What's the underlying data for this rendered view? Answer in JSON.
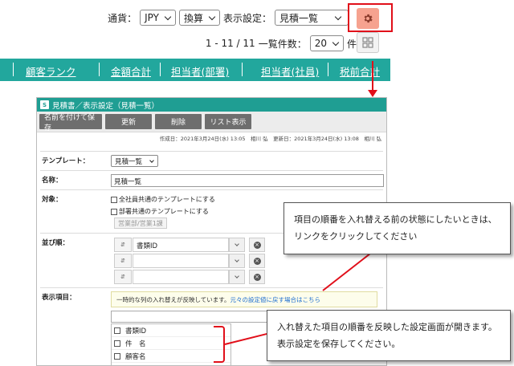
{
  "toolbar": {
    "currency_label": "通貨：",
    "currency_value": "JPY",
    "conversion_value": "換算",
    "display_setting_label": "表示設定：",
    "display_setting_value": "見積一覧",
    "range_text": "1 - 11 / 11",
    "per_page_label": "一覧件数：",
    "per_page_value": "20",
    "per_page_unit": "件"
  },
  "nav": {
    "items": [
      "顧客ランク",
      "金額合計",
      "担当者(部署)",
      "担当者(社員)",
      "税前合計"
    ]
  },
  "dialog": {
    "title": "見積書／表示設定（見積一覧）",
    "buttons": [
      "名前を付けて保存",
      "更新",
      "削除",
      "リスト表示"
    ],
    "meta": "作成日：2021年3月24日(水) 13:05　相川 弘　更新日：2021年3月24日(水) 13:08　相川 弘",
    "template_label": "テンプレート：",
    "template_value": "見積一覧",
    "name_label": "名称：",
    "name_value": "見積一覧",
    "target_label": "対象：",
    "target_opt1": "全社員共通のテンプレートにする",
    "target_opt2": "部署共通のテンプレートにする",
    "target_dept": "営業部/営業1課",
    "sort_label": "並び順：",
    "sort_handle": "⇵",
    "sort_rows": [
      "書類ID",
      "",
      ""
    ],
    "display_label": "表示項目：",
    "notice_text": "一時的な列の入れ替えが反映しています。",
    "notice_link": "元々の設定値に戻す場合はこちら",
    "display_items": [
      "書類ID",
      "件　名",
      "顧客名"
    ]
  },
  "callouts": {
    "callout1_line1": "項目の順番を入れ替える前の状態にしたいときは、",
    "callout1_line2": "リンクをクリックしてください",
    "callout2_line1": "入れ替えた項目の順番を反映した設定画面が開きます。",
    "callout2_line2": "表示設定を保存してください。"
  },
  "colors": {
    "teal": "#22a79d",
    "highlight_red": "#e10f1a",
    "gear_button": "#f6a28f"
  },
  "icons": [
    "gear-icon",
    "grid-icon",
    "chevron-down-icon",
    "sort-handle-icon",
    "remove-icon"
  ]
}
